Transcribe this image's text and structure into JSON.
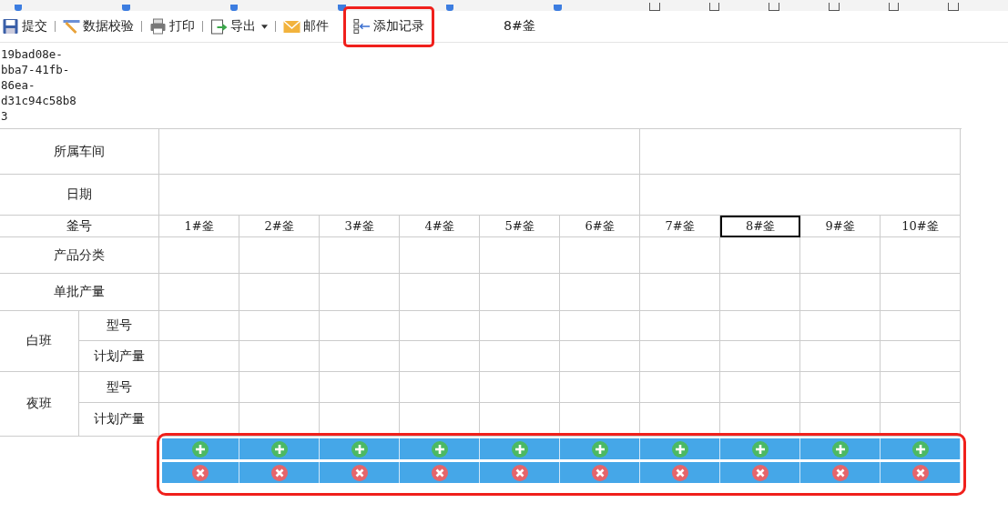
{
  "toolbar": [
    {
      "kind": "button",
      "label": "提交",
      "dropdown": false,
      "highlighted": false
    },
    {
      "kind": "separator"
    },
    {
      "kind": "button",
      "label": "数据校验",
      "dropdown": false,
      "highlighted": false
    },
    {
      "kind": "separator"
    },
    {
      "kind": "button",
      "label": "打印",
      "dropdown": false,
      "highlighted": false
    },
    {
      "kind": "separator"
    },
    {
      "kind": "button",
      "label": "导出",
      "dropdown": true,
      "highlighted": false
    },
    {
      "kind": "separator"
    },
    {
      "kind": "button",
      "label": "邮件",
      "dropdown": false,
      "highlighted": false
    },
    {
      "kind": "button",
      "label": "添加记录",
      "dropdown": false,
      "highlighted": true
    }
  ],
  "current_kettle": "8#釜",
  "record_id": "19bad08e-bba7-41fb-86ea-d31c94c58b83",
  "table": {
    "workshop_label": "所属车间",
    "date_label": "日期",
    "kettle_label": "釜号",
    "kettles": [
      {
        "label": "1#釜",
        "selected": false
      },
      {
        "label": "2#釜",
        "selected": false
      },
      {
        "label": "3#釜",
        "selected": false
      },
      {
        "label": "4#釜",
        "selected": false
      },
      {
        "label": "5#釜",
        "selected": false
      },
      {
        "label": "6#釜",
        "selected": false
      },
      {
        "label": "7#釜",
        "selected": false
      },
      {
        "label": "8#釜",
        "selected": true
      },
      {
        "label": "9#釜",
        "selected": false
      },
      {
        "label": "10#釜",
        "selected": false
      }
    ],
    "rows": [
      {
        "label": "产品分类"
      },
      {
        "label": "单批产量"
      }
    ],
    "shifts": [
      {
        "label": "白班",
        "fields": [
          "型号",
          "计划产量"
        ]
      },
      {
        "label": "夜班",
        "fields": [
          "型号",
          "计划产量"
        ]
      }
    ]
  },
  "action_rows_highlighted": true
}
